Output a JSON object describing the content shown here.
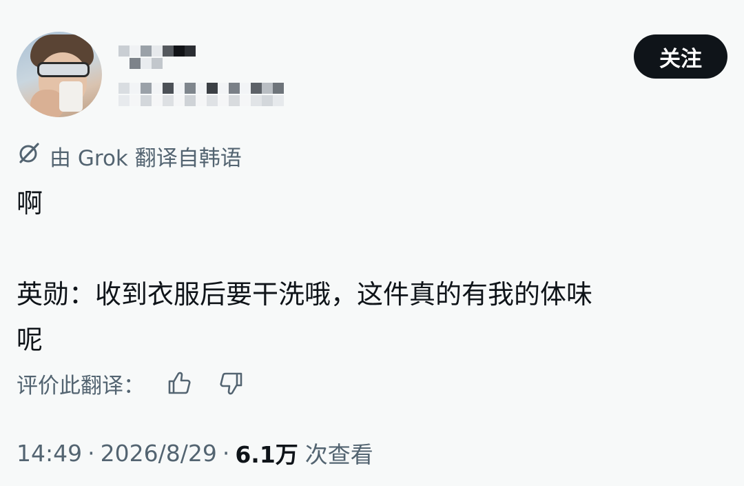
{
  "header": {
    "follow_label": "关注",
    "avatar_icon": "user-avatar",
    "name_obscured": true,
    "handle_obscured": true
  },
  "translation": {
    "icon": "grok-icon",
    "label": "由 Grok 翻译自韩语"
  },
  "post": {
    "text": "啊\n\n英勋：收到衣服后要干洗哦，这件真的有我的体味\n呢"
  },
  "rating": {
    "label": "评价此翻译：",
    "thumbs_up_icon": "thumbs-up-icon",
    "thumbs_down_icon": "thumbs-down-icon"
  },
  "meta": {
    "time": "14:49",
    "separator": "·",
    "date": "2026/8/29",
    "views_count": "6.1万",
    "views_label": "次查看"
  },
  "colors": {
    "background": "#f7f9f9",
    "text_primary": "#0f1419",
    "text_secondary": "#536471",
    "button_bg": "#0f1419",
    "button_text": "#ffffff"
  }
}
